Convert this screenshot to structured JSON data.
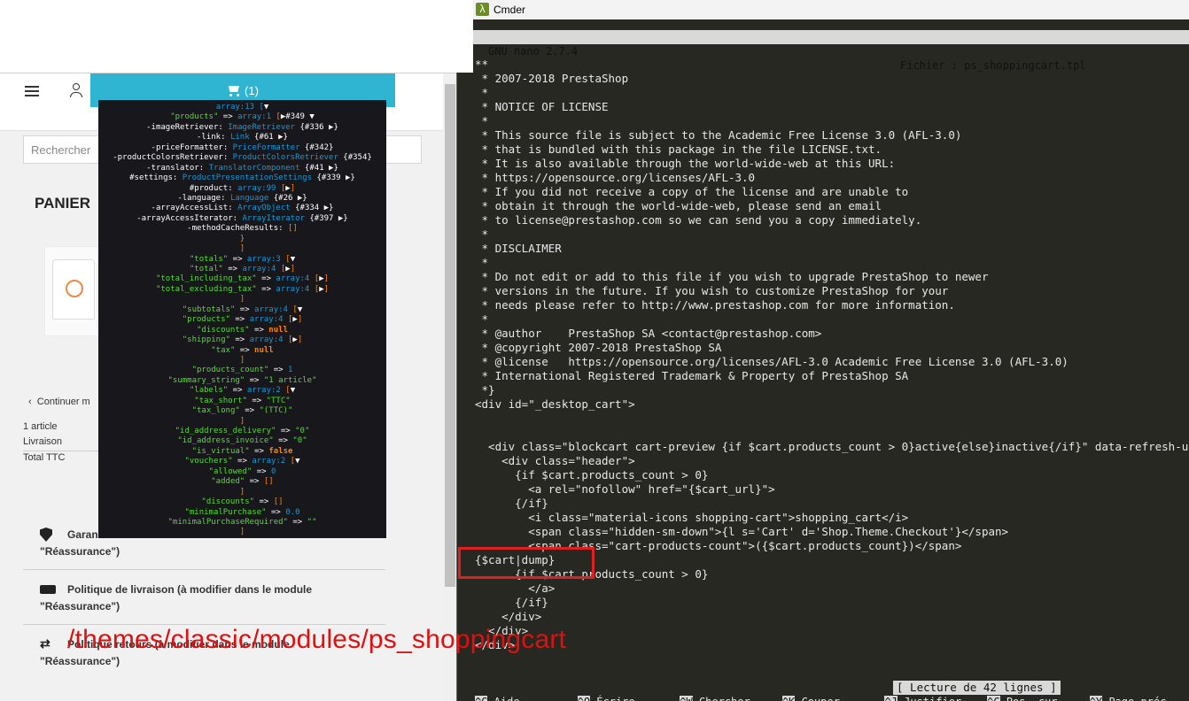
{
  "shop": {
    "cart_label": "(1)",
    "search_placeholder": "Rechercher",
    "panier_title": "PANIER",
    "continue_label": "Continuer m",
    "summary_articles": "1 article",
    "summary_shipping": "Livraison",
    "summary_total": "Total TTC",
    "reassurance": [
      {
        "line1": "Garan",
        "line2": "\"Réassurance\")",
        "icon": "shield-icon"
      },
      {
        "line1": "Politique de livraison (à modifier dans le module",
        "line2": "\"Réassurance\")",
        "icon": "truck-icon"
      },
      {
        "line1": "Politique retours (à modifier dans le module",
        "line2": "\"Réassurance\")",
        "icon": "arrows-icon"
      }
    ]
  },
  "dump": {
    "lines": [
      [
        [
          "array:13 [",
          "c-type"
        ],
        [
          "▼",
          "c-w"
        ]
      ],
      [
        [
          "\"products\"",
          "c-key"
        ],
        [
          " => ",
          "c-w"
        ],
        [
          "array:1",
          "c-type"
        ],
        [
          " [",
          "c-br"
        ],
        [
          "▶#349 ▼",
          "c-w"
        ]
      ],
      [
        [
          "-imageRetriever",
          "c-prop"
        ],
        [
          ": ",
          "c-w"
        ],
        [
          "ImageRetriever",
          "c-obj"
        ],
        [
          " {#336 ",
          "c-w"
        ],
        [
          "▶}",
          "c-w"
        ]
      ],
      [
        [
          "-link",
          "c-prop"
        ],
        [
          ": ",
          "c-w"
        ],
        [
          "Link",
          "c-obj"
        ],
        [
          " {#61 ",
          "c-w"
        ],
        [
          "▶}",
          "c-w"
        ]
      ],
      [
        [
          "-priceFormatter",
          "c-prop"
        ],
        [
          ": ",
          "c-w"
        ],
        [
          "PriceFormatter",
          "c-obj"
        ],
        [
          " {#342}",
          "c-w"
        ]
      ],
      [
        [
          "-productColorsRetriever",
          "c-prop"
        ],
        [
          ": ",
          "c-w"
        ],
        [
          "ProductColorsRetriever",
          "c-obj"
        ],
        [
          " {#354}",
          "c-w"
        ]
      ],
      [
        [
          "-translator",
          "c-prop"
        ],
        [
          ": ",
          "c-w"
        ],
        [
          "TranslatorComponent",
          "c-obj"
        ],
        [
          " {#41 ",
          "c-w"
        ],
        [
          "▶}",
          "c-w"
        ]
      ],
      [
        [
          "#settings",
          "c-prop"
        ],
        [
          ": ",
          "c-w"
        ],
        [
          "ProductPresentationSettings",
          "c-obj"
        ],
        [
          " {#339 ",
          "c-w"
        ],
        [
          "▶}",
          "c-w"
        ]
      ],
      [
        [
          "#product",
          "c-prop"
        ],
        [
          ": ",
          "c-w"
        ],
        [
          "array:99",
          "c-type"
        ],
        [
          " [",
          "c-br"
        ],
        [
          "▶",
          "c-w"
        ],
        [
          "]",
          "c-br"
        ]
      ],
      [
        [
          "-language",
          "c-prop"
        ],
        [
          ": ",
          "c-w"
        ],
        [
          "Language",
          "c-obj"
        ],
        [
          " {#26 ",
          "c-w"
        ],
        [
          "▶}",
          "c-w"
        ]
      ],
      [
        [
          "-arrayAccessList",
          "c-prop"
        ],
        [
          ": ",
          "c-w"
        ],
        [
          "ArrayObject",
          "c-obj"
        ],
        [
          " {#334 ",
          "c-w"
        ],
        [
          "▶}",
          "c-w"
        ]
      ],
      [
        [
          "-arrayAccessIterator",
          "c-prop"
        ],
        [
          ": ",
          "c-w"
        ],
        [
          "ArrayIterator",
          "c-obj"
        ],
        [
          " {#397 ",
          "c-w"
        ],
        [
          "▶}",
          "c-w"
        ]
      ],
      [
        [
          "-methodCacheResults",
          "c-prop"
        ],
        [
          ": ",
          "c-w"
        ],
        [
          "[]",
          "c-br"
        ]
      ],
      [
        [
          "}",
          "c-br"
        ]
      ],
      [
        [
          "]",
          "c-br"
        ]
      ],
      [
        [
          "\"totals\"",
          "c-key"
        ],
        [
          " => ",
          "c-w"
        ],
        [
          "array:3",
          "c-type"
        ],
        [
          " [",
          "c-br"
        ],
        [
          "▼",
          "c-w"
        ]
      ],
      [
        [
          "\"total\"",
          "c-key"
        ],
        [
          " => ",
          "c-w"
        ],
        [
          "array:4",
          "c-type"
        ],
        [
          " [",
          "c-br"
        ],
        [
          "▶",
          "c-w"
        ],
        [
          "]",
          "c-br"
        ]
      ],
      [
        [
          "\"total_including_tax\"",
          "c-key"
        ],
        [
          " => ",
          "c-w"
        ],
        [
          "array:4",
          "c-type"
        ],
        [
          " [",
          "c-br"
        ],
        [
          "▶",
          "c-w"
        ],
        [
          "]",
          "c-br"
        ]
      ],
      [
        [
          "\"total_excluding_tax\"",
          "c-key"
        ],
        [
          " => ",
          "c-w"
        ],
        [
          "array:4",
          "c-type"
        ],
        [
          " [",
          "c-br"
        ],
        [
          "▶",
          "c-w"
        ],
        [
          "]",
          "c-br"
        ]
      ],
      [
        [
          "]",
          "c-br"
        ]
      ],
      [
        [
          "\"subtotals\"",
          "c-key"
        ],
        [
          " => ",
          "c-w"
        ],
        [
          "array:4",
          "c-type"
        ],
        [
          " [",
          "c-br"
        ],
        [
          "▼",
          "c-w"
        ]
      ],
      [
        [
          "\"products\"",
          "c-key"
        ],
        [
          " => ",
          "c-w"
        ],
        [
          "array:4",
          "c-type"
        ],
        [
          " [",
          "c-br"
        ],
        [
          "▶",
          "c-w"
        ],
        [
          "]",
          "c-br"
        ]
      ],
      [
        [
          "\"discounts\"",
          "c-key"
        ],
        [
          " => ",
          "c-w"
        ],
        [
          "null",
          "c-null"
        ]
      ],
      [
        [
          "\"shipping\"",
          "c-key"
        ],
        [
          " => ",
          "c-w"
        ],
        [
          "array:4",
          "c-type"
        ],
        [
          " [",
          "c-br"
        ],
        [
          "▶",
          "c-w"
        ],
        [
          "]",
          "c-br"
        ]
      ],
      [
        [
          "\"tax\"",
          "c-key"
        ],
        [
          " => ",
          "c-w"
        ],
        [
          "null",
          "c-null"
        ]
      ],
      [
        [
          "]",
          "c-br"
        ]
      ],
      [
        [
          "\"products_count\"",
          "c-key"
        ],
        [
          " => ",
          "c-w"
        ],
        [
          "1",
          "c-num"
        ]
      ],
      [
        [
          "\"summary_string\"",
          "c-key"
        ],
        [
          " => ",
          "c-w"
        ],
        [
          "\"1 article\"",
          "c-str"
        ]
      ],
      [
        [
          "\"labels\"",
          "c-key"
        ],
        [
          " => ",
          "c-w"
        ],
        [
          "array:2",
          "c-type"
        ],
        [
          " [",
          "c-br"
        ],
        [
          "▼",
          "c-w"
        ]
      ],
      [
        [
          "\"tax_short\"",
          "c-key"
        ],
        [
          " => ",
          "c-w"
        ],
        [
          "\"TTC\"",
          "c-str"
        ]
      ],
      [
        [
          "\"tax_long\"",
          "c-key"
        ],
        [
          " => ",
          "c-w"
        ],
        [
          "\"(TTC)\"",
          "c-str"
        ]
      ],
      [
        [
          "]",
          "c-br"
        ]
      ],
      [
        [
          "\"id_address_delivery\"",
          "c-key"
        ],
        [
          " => ",
          "c-w"
        ],
        [
          "\"0\"",
          "c-str"
        ]
      ],
      [
        [
          "\"id_address_invoice\"",
          "c-key"
        ],
        [
          " => ",
          "c-w"
        ],
        [
          "\"0\"",
          "c-str"
        ]
      ],
      [
        [
          "\"is_virtual\"",
          "c-key"
        ],
        [
          " => ",
          "c-w"
        ],
        [
          "false",
          "c-null"
        ]
      ],
      [
        [
          "\"vouchers\"",
          "c-key"
        ],
        [
          " => ",
          "c-w"
        ],
        [
          "array:2",
          "c-type"
        ],
        [
          " [",
          "c-br"
        ],
        [
          "▼",
          "c-w"
        ]
      ],
      [
        [
          "\"allowed\"",
          "c-key"
        ],
        [
          " => ",
          "c-w"
        ],
        [
          "0",
          "c-num"
        ]
      ],
      [
        [
          "\"added\"",
          "c-key"
        ],
        [
          " => ",
          "c-w"
        ],
        [
          "[]",
          "c-br"
        ]
      ],
      [
        [
          "]",
          "c-br"
        ]
      ],
      [
        [
          "\"discounts\"",
          "c-key"
        ],
        [
          " => ",
          "c-w"
        ],
        [
          "[]",
          "c-br"
        ]
      ],
      [
        [
          "\"minimalPurchase\"",
          "c-key"
        ],
        [
          " => ",
          "c-w"
        ],
        [
          "0.0",
          "c-num"
        ]
      ],
      [
        [
          "\"minimalPurchaseRequired\"",
          "c-key"
        ],
        [
          " => ",
          "c-w"
        ],
        [
          "\"\"",
          "c-str"
        ]
      ],
      [
        [
          "]",
          "c-br"
        ]
      ]
    ]
  },
  "cmder": {
    "window_title": "Cmder",
    "nano_version": "GNU nano 2.7.4",
    "file_label": "Fichier : ps_shoppingcart.tpl",
    "lines": [
      "**",
      " * 2007-2018 PrestaShop",
      " *",
      " * NOTICE OF LICENSE",
      " *",
      " * This source file is subject to the Academic Free License 3.0 (AFL-3.0)",
      " * that is bundled with this package in the file LICENSE.txt.",
      " * It is also available through the world-wide-web at this URL:",
      " * https://opensource.org/licenses/AFL-3.0",
      " * If you did not receive a copy of the license and are unable to",
      " * obtain it through the world-wide-web, please send an email",
      " * to license@prestashop.com so we can send you a copy immediately.",
      " *",
      " * DISCLAIMER",
      " *",
      " * Do not edit or add to this file if you wish to upgrade PrestaShop to newer",
      " * versions in the future. If you wish to customize PrestaShop for your",
      " * needs please refer to http://www.prestashop.com for more information.",
      " *",
      " * @author    PrestaShop SA <contact@prestashop.com>",
      " * @copyright 2007-2018 PrestaShop SA",
      " * @license   https://opensource.org/licenses/AFL-3.0 Academic Free License 3.0 (AFL-3.0)",
      " * International Registered Trademark & Property of PrestaShop SA",
      " *}",
      "<div id=\"_desktop_cart\">",
      "",
      "",
      "  <div class=\"blockcart cart-preview {if $cart.products_count > 0}active{else}inactive{/if}\" data-refresh-url=\"{$refresh_url}\">",
      "    <div class=\"header\">",
      "      {if $cart.products_count > 0}",
      "        <a rel=\"nofollow\" href=\"{$cart_url}\">",
      "      {/if}",
      "        <i class=\"material-icons shopping-cart\">shopping_cart</i>",
      "        <span class=\"hidden-sm-down\">{l s='Cart' d='Shop.Theme.Checkout'}</span>",
      "        <span class=\"cart-products-count\">({$cart.products_count})</span>",
      "{$cart|dump}",
      "      {if $cart.products_count > 0}",
      "        </a>",
      "      {/if}",
      "    </div>",
      "  </div>",
      "</div>"
    ],
    "status_message": "[ Lecture de 42 lignes ]",
    "shortcuts": [
      {
        "key": "^G",
        "label": "Aide"
      },
      {
        "key": "^O",
        "label": "Écrire"
      },
      {
        "key": "^W",
        "label": "Chercher"
      },
      {
        "key": "^K",
        "label": "Couper"
      },
      {
        "key": "^J",
        "label": "Justifier"
      },
      {
        "key": "^C",
        "label": "Pos. cur."
      },
      {
        "key": "^Y",
        "label": "Page préc."
      }
    ]
  },
  "annotation": {
    "path_text": "/themes/classic/modules/ps_shoppingcart"
  },
  "colors": {
    "cart_accent": "#2fb5d2",
    "annotation_red": "#e01010",
    "terminal_bg": "#272822",
    "dump_bg": "#18171b"
  }
}
